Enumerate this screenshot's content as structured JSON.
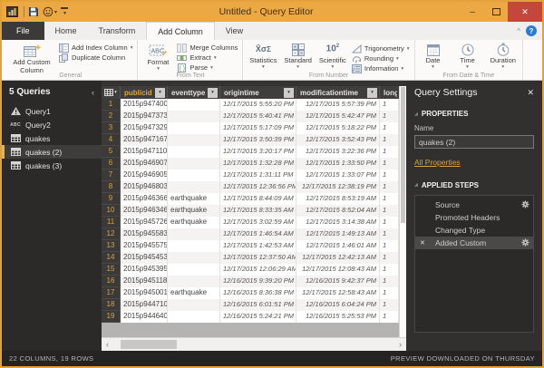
{
  "titlebar": {
    "title": "Untitled - Query Editor"
  },
  "glyphs": {
    "dropdown": "▾",
    "chevron_up": "^",
    "chevron_left": "‹",
    "chevron_right": "›",
    "close": "✕",
    "minimize": "–",
    "help": "?",
    "expander": "◢"
  },
  "tabs": {
    "file": "File",
    "home": "Home",
    "transform": "Transform",
    "add_column": "Add Column",
    "view": "View",
    "active": "Add Column"
  },
  "ribbon": {
    "groups": [
      {
        "label": "General",
        "big": {
          "label": "Add Custom Column"
        },
        "items": [
          {
            "label": "Add Index Column",
            "dropdown": true
          },
          {
            "label": "Duplicate Column",
            "dropdown": false
          }
        ]
      },
      {
        "label": "From Text",
        "big": {
          "label": "Format",
          "dropdown": true
        },
        "items": [
          {
            "label": "Merge Columns",
            "dropdown": false
          },
          {
            "label": "Extract",
            "dropdown": true
          },
          {
            "label": "Parse",
            "dropdown": true
          }
        ]
      },
      {
        "label": "From Number",
        "medium": [
          {
            "label": "Statistics"
          },
          {
            "label": "Standard"
          },
          {
            "label": "Scientific"
          }
        ],
        "items": [
          {
            "label": "Trigonometry",
            "dropdown": true
          },
          {
            "label": "Rounding",
            "dropdown": true
          },
          {
            "label": "Information",
            "dropdown": true
          }
        ]
      },
      {
        "label": "From Date & Time",
        "medium": [
          {
            "label": "Date"
          },
          {
            "label": "Time"
          },
          {
            "label": "Duration"
          }
        ]
      }
    ]
  },
  "queries_panel": {
    "header": "5 Queries",
    "items": [
      {
        "label": "Query1",
        "icon": "warning"
      },
      {
        "label": "Query2",
        "icon": "abc"
      },
      {
        "label": "quakes",
        "icon": "table"
      },
      {
        "label": "quakes (2)",
        "icon": "table",
        "selected": true
      },
      {
        "label": "quakes (3)",
        "icon": "table"
      }
    ]
  },
  "table": {
    "columns": [
      {
        "name": "publicid",
        "selected": true,
        "filter": true
      },
      {
        "name": "eventtype",
        "filter": true
      },
      {
        "name": "origintime",
        "filter": true,
        "datetime": true
      },
      {
        "name": "modificationtime",
        "filter": true,
        "datetime": true
      },
      {
        "name": "longi",
        "truncated": true
      }
    ],
    "longi_fragment": "1",
    "rows": [
      [
        "2015p947400",
        "",
        "12/17/2015 5:55:20 PM",
        "12/17/2015 5:57:39 PM"
      ],
      [
        "2015p947373",
        "",
        "12/17/2015 5:40:41 PM",
        "12/17/2015 5:42:47 PM"
      ],
      [
        "2015p947329",
        "",
        "12/17/2015 5:17:09 PM",
        "12/17/2015 5:18:22 PM"
      ],
      [
        "2015p947167",
        "",
        "12/17/2015 3:50:39 PM",
        "12/17/2015 3:52:43 PM"
      ],
      [
        "2015p947110",
        "",
        "12/17/2015 3:20:17 PM",
        "12/17/2015 3:22:36 PM"
      ],
      [
        "2015p946907",
        "",
        "12/17/2015 1:32:28 PM",
        "12/17/2015 1:33:50 PM"
      ],
      [
        "2015p946905",
        "",
        "12/17/2015 1:31:11 PM",
        "12/17/2015 1:33:07 PM"
      ],
      [
        "2015p946803",
        "",
        "12/17/2015 12:36:56 PM",
        "12/17/2015 12:38:19 PM"
      ],
      [
        "2015p946366",
        "earthquake",
        "12/17/2015 8:44:09 AM",
        "12/17/2015 8:53:19 AM"
      ],
      [
        "2015p946346",
        "earthquake",
        "12/17/2015 8:33:35 AM",
        "12/17/2015 8:52:04 AM"
      ],
      [
        "2015p945726",
        "earthquake",
        "12/17/2015 3:02:59 AM",
        "12/17/2015 3:14:38 AM"
      ],
      [
        "2015p945583",
        "",
        "12/17/2015 1:46:54 AM",
        "12/17/2015 1:49:13 AM"
      ],
      [
        "2015p945575",
        "",
        "12/17/2015 1:42:53 AM",
        "12/17/2015 1:46:01 AM"
      ],
      [
        "2015p945453",
        "",
        "12/17/2015 12:37:50 AM",
        "12/17/2015 12:42:13 AM"
      ],
      [
        "2015p945395",
        "",
        "12/17/2015 12:06:29 AM",
        "12/17/2015 12:08:43 AM"
      ],
      [
        "2015p945118",
        "",
        "12/16/2015 9:39:20 PM",
        "12/16/2015 9:42:37 PM"
      ],
      [
        "2015p945001",
        "earthquake",
        "12/16/2015 8:36:38 PM",
        "12/17/2015 12:58:43 AM"
      ],
      [
        "2015p944710",
        "",
        "12/16/2015 6:01:51 PM",
        "12/16/2015 6:04:24 PM"
      ],
      [
        "2015p944640",
        "",
        "12/16/2015 5:24:21 PM",
        "12/16/2015 5:25:53 PM"
      ]
    ]
  },
  "query_settings": {
    "title": "Query Settings",
    "sections": {
      "properties": "PROPERTIES",
      "applied_steps": "APPLIED STEPS"
    },
    "name_label": "Name",
    "name_value": "quakes (2)",
    "all_properties_link": "All Properties",
    "steps": [
      {
        "label": "Source",
        "gear": true
      },
      {
        "label": "Promoted Headers"
      },
      {
        "label": "Changed Type"
      },
      {
        "label": "Added Custom",
        "gear": true,
        "selected": true,
        "deletable": true
      }
    ]
  },
  "status_bar": {
    "left": "22 COLUMNS, 19 ROWS",
    "right": "PREVIEW DOWNLOADED ON THURSDAY"
  },
  "colors": {
    "accent_gold": "#EBA843",
    "close_red": "#C3473A",
    "help_blue": "#2B7BD3",
    "selected_text": "#E2A33B",
    "panel_dark": "#2B2A29"
  }
}
